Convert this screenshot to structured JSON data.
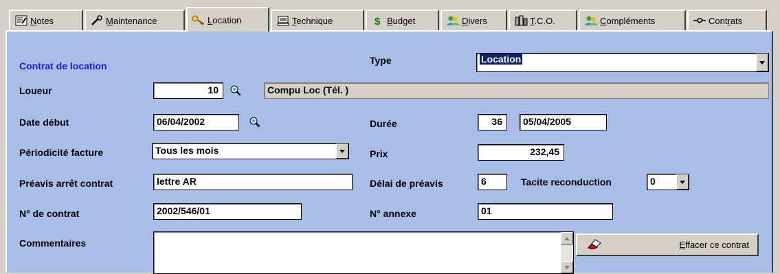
{
  "tabs": [
    {
      "id": "notes",
      "pre": "",
      "u": "N",
      "post": "otes",
      "icon": "notes-icon"
    },
    {
      "id": "maintenance",
      "pre": "",
      "u": "M",
      "post": "aintenance",
      "icon": "wrench-icon"
    },
    {
      "id": "location",
      "pre": "",
      "u": "L",
      "post": "ocation",
      "icon": "key-icon"
    },
    {
      "id": "technique",
      "pre": "",
      "u": "T",
      "post": "echnique",
      "icon": "computer-icon"
    },
    {
      "id": "budget",
      "pre": "",
      "u": "B",
      "post": "udget",
      "icon": "dollar-icon"
    },
    {
      "id": "divers",
      "pre": "",
      "u": "D",
      "post": "ivers",
      "icon": "people-icon"
    },
    {
      "id": "tco",
      "pre": "",
      "u": "T",
      "post": ".C.O.",
      "icon": "coins-icon"
    },
    {
      "id": "complements",
      "pre": "",
      "u": "C",
      "post": "ompléments",
      "icon": "people-icon"
    },
    {
      "id": "contrats",
      "pre": "Cont",
      "u": "r",
      "post": "ats",
      "icon": "handshake-icon"
    }
  ],
  "active_tab": "location",
  "form": {
    "section_title": "Contrat de location",
    "type_label": "Type",
    "type_value": "Location",
    "loueur_label": "Loueur",
    "loueur_code": "10",
    "loueur_name": "Compu Loc  (Tél. )",
    "date_debut_label": "Date début",
    "date_debut": "06/04/2002",
    "duree_label": "Durée",
    "duree": "36",
    "date_fin": "05/04/2005",
    "periodicite_label": "Périodicité facture",
    "periodicite": "Tous les mois",
    "prix_label": "Prix",
    "prix": "232,45",
    "preavis_label": "Préavis arrêt contrat",
    "preavis": "lettre AR",
    "delai_label": "Délai de préavis",
    "delai": "6",
    "tacite_label": "Tacite reconduction",
    "tacite": "0",
    "ncontrat_label": "N° de contrat",
    "ncontrat": "2002/546/01",
    "nannexe_label": "N° annexe",
    "nannexe": "01",
    "commentaires_label": "Commentaires",
    "commentaires": ""
  },
  "erase_button": {
    "u": "E",
    "post": "ffacer ce contrat"
  },
  "colors": {
    "panel": "#a8bde8",
    "title": "#1c1cd0",
    "selection": "#0a246a",
    "chrome": "#d4d0c8"
  }
}
